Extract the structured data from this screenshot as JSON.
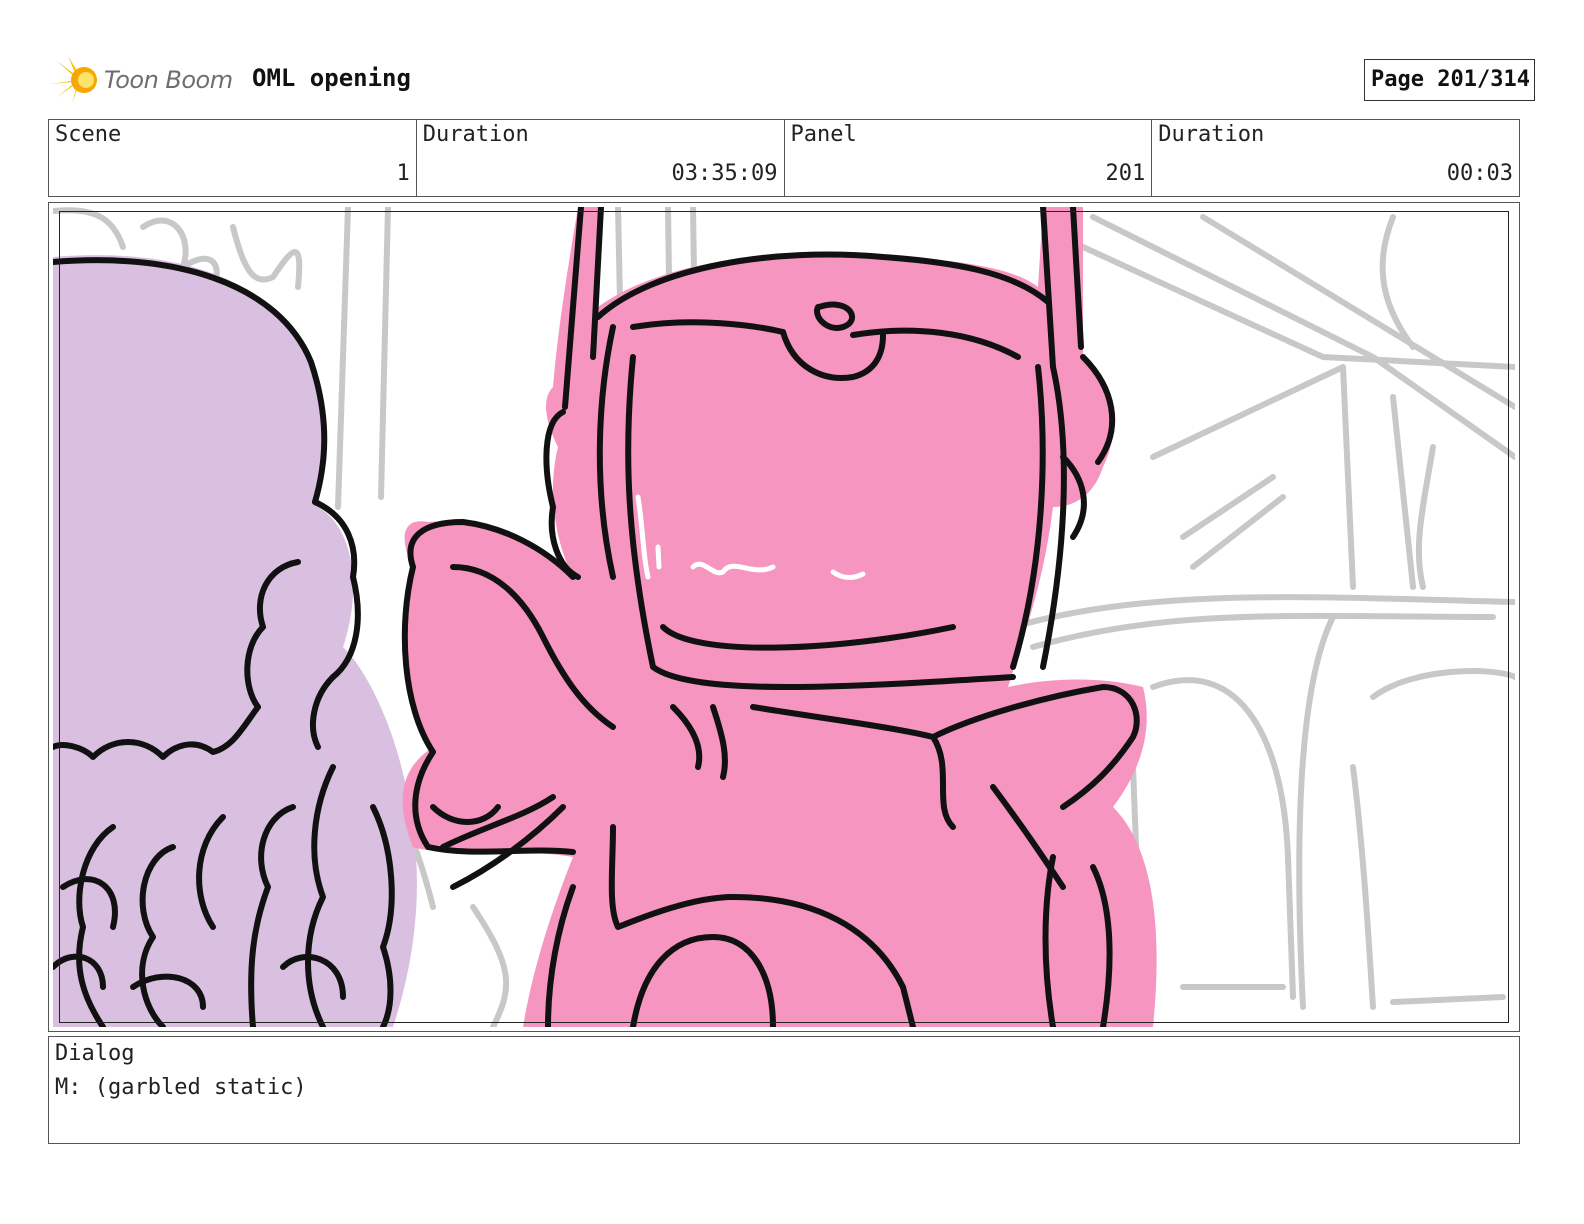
{
  "header": {
    "logo_text": "Toon Boom",
    "project_title": "OML opening",
    "page_label": "Page 201/314"
  },
  "info": {
    "scene_label": "Scene",
    "scene_value": "1",
    "scene_duration_label": "Duration",
    "scene_duration_value": "03:35:09",
    "panel_label": "Panel",
    "panel_value": "201",
    "panel_duration_label": "Duration",
    "panel_duration_value": "00:03"
  },
  "dialog": {
    "label": "Dialog",
    "text": "M: (garbled static)"
  },
  "colors": {
    "robot_pink": "#f595c0",
    "character_lavender": "#d9bfe0",
    "sketch_gray": "#c8c8c8",
    "line_black": "#111111",
    "logo_yellow": "#f5c400"
  }
}
